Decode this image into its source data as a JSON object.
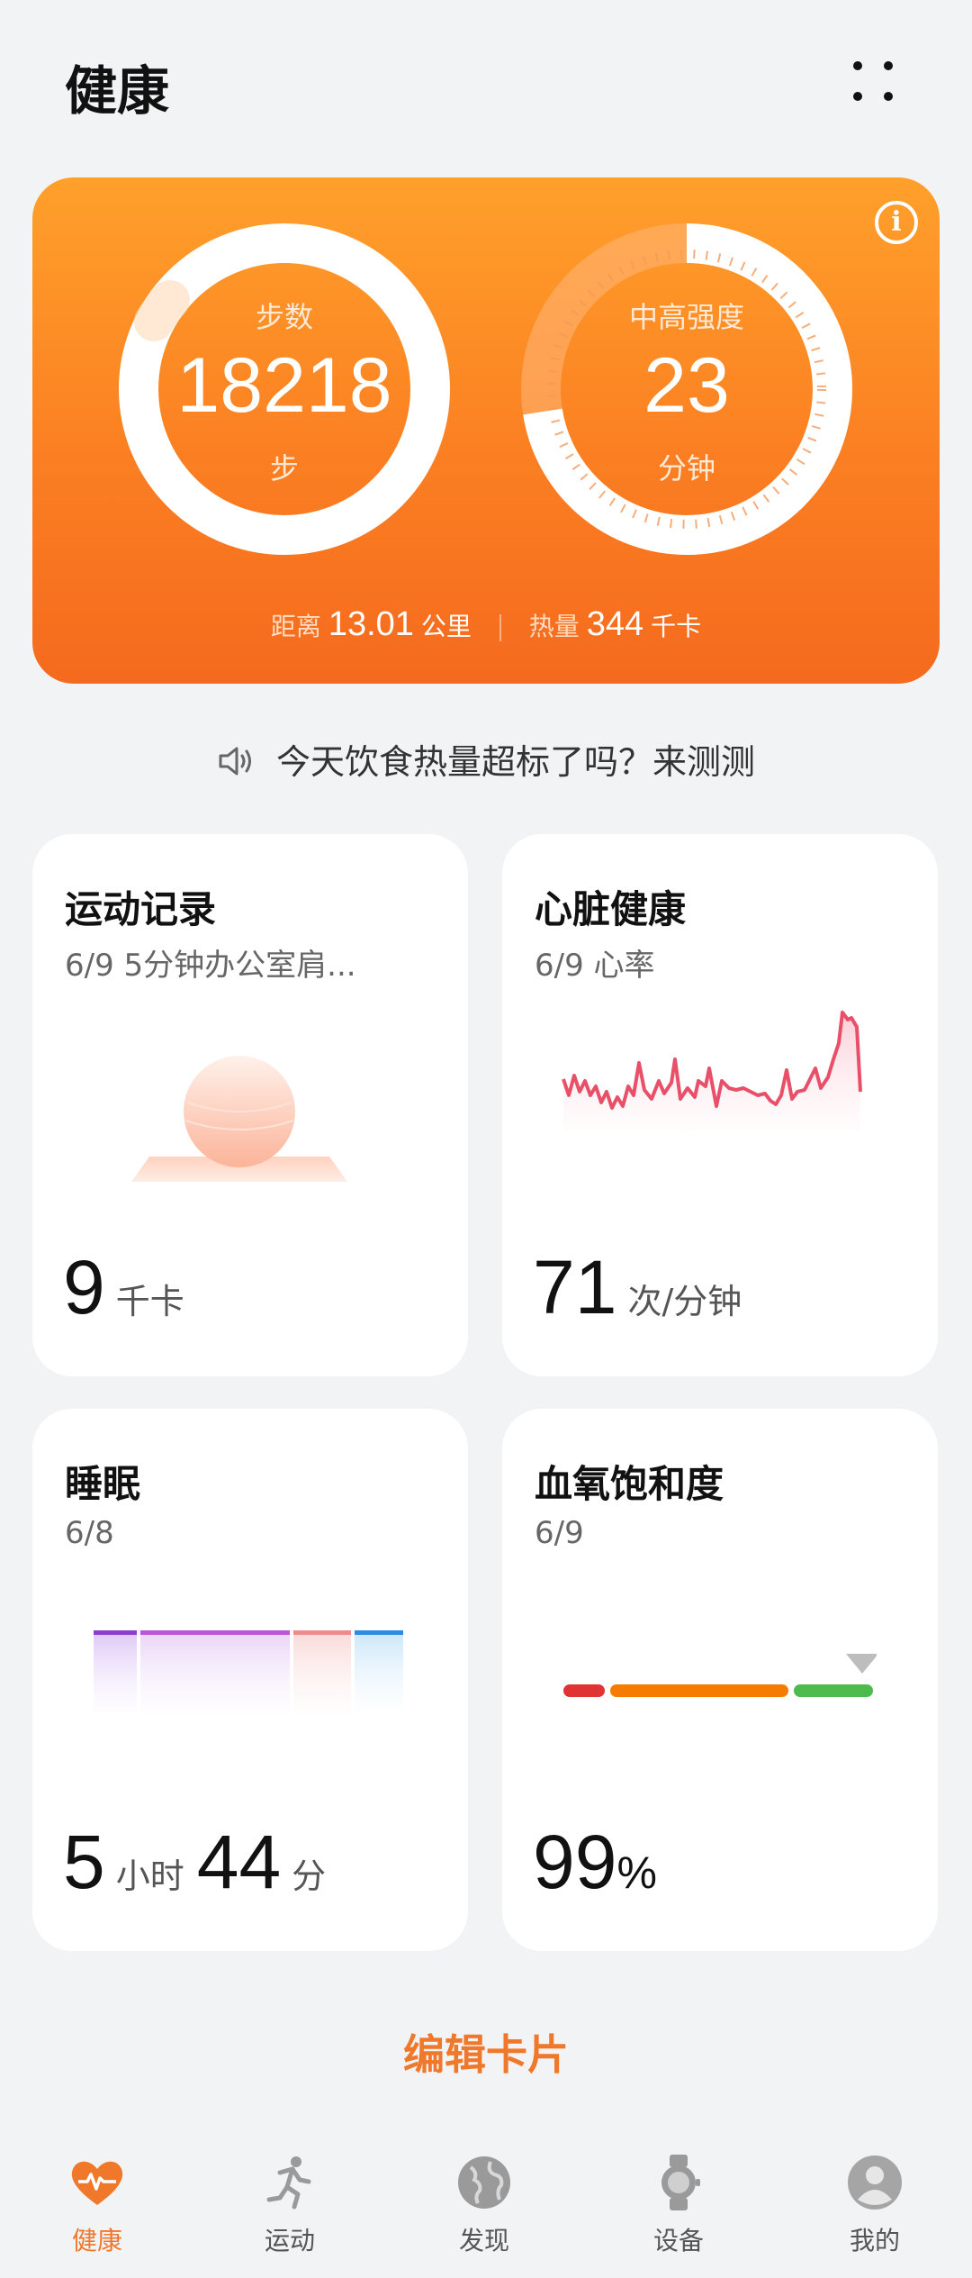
{
  "header": {
    "title": "健康"
  },
  "summary": {
    "steps": {
      "label": "步数",
      "value": "18218",
      "unit": "步"
    },
    "intensity": {
      "label": "中高强度",
      "value": "23",
      "unit": "分钟"
    },
    "distance": {
      "label": "距离",
      "value": "13.01",
      "unit": "公里"
    },
    "calories": {
      "label": "热量",
      "value": "344",
      "unit": "千卡"
    }
  },
  "prompt": "今天饮食热量超标了吗？来测测",
  "cards": {
    "exercise": {
      "title": "运动记录",
      "subtitle": "6/9 5分钟办公室肩...",
      "value": "9",
      "unit": "千卡"
    },
    "heart": {
      "title": "心脏健康",
      "subtitle": "6/9 心率",
      "value": "71",
      "unit": "次/分钟"
    },
    "sleep": {
      "title": "睡眠",
      "subtitle": "6/8",
      "hours": "5",
      "hours_unit": "小时",
      "minutes": "44",
      "minutes_unit": "分"
    },
    "spo2": {
      "title": "血氧饱和度",
      "subtitle": "6/9",
      "value": "99",
      "unit": "%"
    }
  },
  "edit_label": "编辑卡片",
  "tabs": [
    {
      "label": "健康",
      "icon": "heart-icon"
    },
    {
      "label": "运动",
      "icon": "runner-icon"
    },
    {
      "label": "发现",
      "icon": "globe-icon"
    },
    {
      "label": "设备",
      "icon": "watch-icon"
    },
    {
      "label": "我的",
      "icon": "profile-icon"
    }
  ],
  "colors": {
    "accent": "#f0782a",
    "heart_line": "#e8506a",
    "spo2_low": "#e03434",
    "spo2_mid": "#f57c00",
    "spo2_high": "#4cba4c"
  }
}
